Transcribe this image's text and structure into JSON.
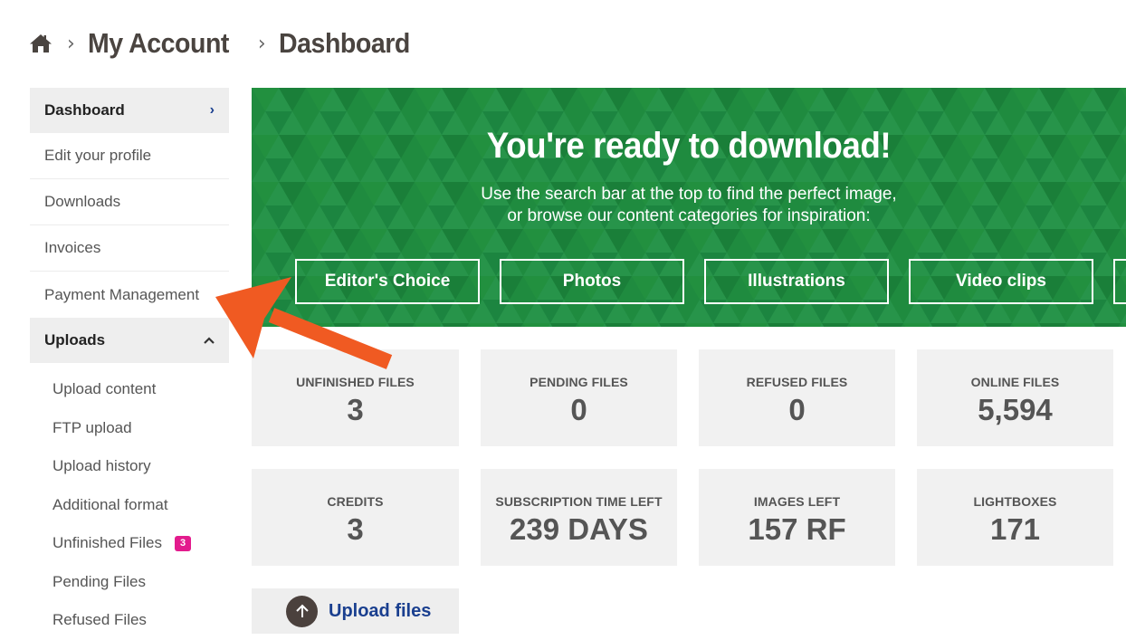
{
  "breadcrumb": {
    "home_icon": "home-icon",
    "items": [
      "My Account",
      "Dashboard"
    ]
  },
  "sidebar": {
    "dashboard": "Dashboard",
    "items": [
      "Edit your profile",
      "Downloads",
      "Invoices",
      "Payment Management"
    ],
    "uploads_header": "Uploads",
    "upload_items": [
      "Upload content",
      "FTP upload",
      "Upload history",
      "Additional format",
      "Unfinished Files",
      "Pending Files",
      "Refused Files"
    ],
    "unfinished_badge": "3"
  },
  "hero": {
    "title": "You're ready to download!",
    "subtitle_line1": "Use the search bar at the top to find the perfect image,",
    "subtitle_line2": "or browse our content categories for inspiration:",
    "buttons": [
      "Editor's Choice",
      "Photos",
      "Illustrations",
      "Video clips"
    ],
    "background_color": "#1e8a3e"
  },
  "stats": [
    {
      "label": "UNFINISHED FILES",
      "value": "3"
    },
    {
      "label": "PENDING FILES",
      "value": "0"
    },
    {
      "label": "REFUSED FILES",
      "value": "0"
    },
    {
      "label": "ONLINE FILES",
      "value": "5,594"
    },
    {
      "label": "CREDITS",
      "value": "3"
    },
    {
      "label": "SUBSCRIPTION TIME LEFT",
      "value": "239 DAYS"
    },
    {
      "label": "IMAGES LEFT",
      "value": "157 RF"
    },
    {
      "label": "LIGHTBOXES",
      "value": "171"
    }
  ],
  "upload_button": {
    "label": "Upload files",
    "icon": "arrow-up-icon"
  },
  "colors": {
    "accent_blue": "#1a3f8f",
    "badge_pink": "#e31b8d",
    "annotation_arrow": "#f05a22"
  }
}
